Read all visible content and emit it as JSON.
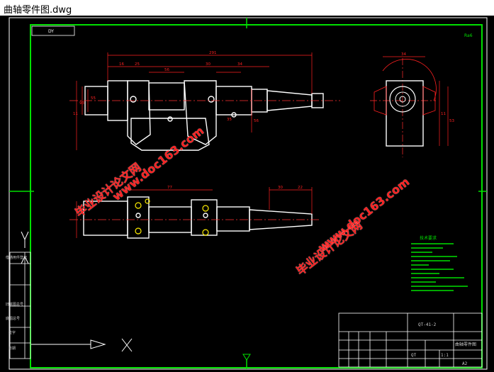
{
  "window": {
    "title": "曲轴零件图.dwg"
  },
  "drawing": {
    "view_label": "DY",
    "roughness_label": "Ra6",
    "top_dims": {
      "overall": "291",
      "mid": "35",
      "r1": "16",
      "r2": "25",
      "r3": "56",
      "r4": "30",
      "r5": "34"
    },
    "left_dims": {
      "h1": "93",
      "h2": "55",
      "h3": "56",
      "h4": "11"
    },
    "side_dims": {
      "top": "34",
      "right1": "11",
      "right2": "53"
    },
    "bottom_dims": {
      "d1": "77",
      "d2": "30",
      "d3": "22"
    },
    "tech_notes_title": "技术要求"
  },
  "watermark": {
    "line1_cn": "毕业设计论文网",
    "line2_url": "www.doc163.com",
    "line3_url": "www.doc163.com",
    "line4_cn": "毕业设计论文网"
  },
  "title_block": {
    "drawing_no": "QT-41-2",
    "part_name": "曲轴零件图",
    "sheet_size": "A2",
    "scale": "1:1",
    "material": "QT"
  },
  "left_table": {
    "rows": [
      "借通用件登记",
      "旧底图总号",
      "底图总号",
      "签字",
      "日期"
    ]
  },
  "colors": {
    "frame": "#00e000",
    "dim": "#ff2020",
    "part": "#ffffff",
    "center": "#ff3030",
    "bg": "#000000"
  }
}
